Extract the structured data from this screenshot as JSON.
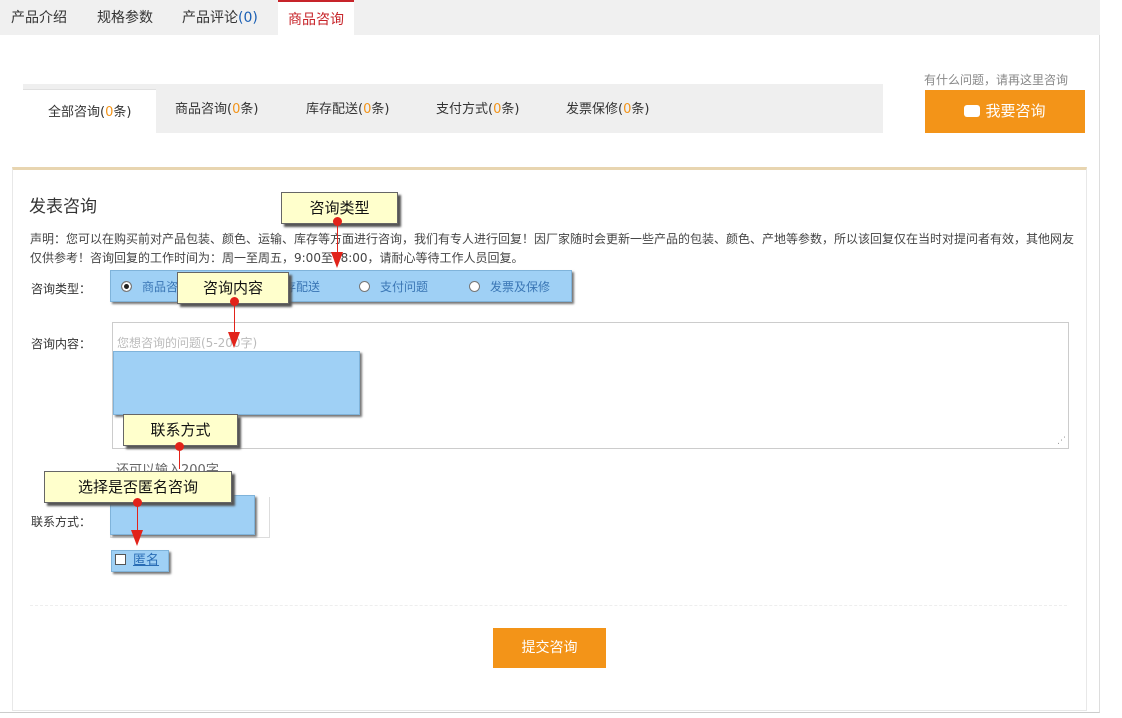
{
  "top_tabs": {
    "intro": "产品介绍",
    "specs": "规格参数",
    "reviews": "产品评论",
    "reviews_count": "(0)",
    "consult": "商品咨询"
  },
  "sub_tabs": [
    {
      "pre": "全部咨询(",
      "n": "0",
      "post": "条)"
    },
    {
      "pre": "商品咨询(",
      "n": "0",
      "post": "条)"
    },
    {
      "pre": "库存配送(",
      "n": "0",
      "post": "条)"
    },
    {
      "pre": "支付方式(",
      "n": "0",
      "post": "条)"
    },
    {
      "pre": "发票保修(",
      "n": "0",
      "post": "条)"
    }
  ],
  "ask": {
    "hint": "有什么问题，请再这里咨询",
    "button": "我要咨询",
    "icon": "chat-bubble-icon"
  },
  "form": {
    "title": "发表咨询",
    "notice": "声明：您可以在购买前对产品包装、颜色、运输、库存等方面进行咨询，我们有专人进行回复！因厂家随时会更新一些产品的包装、颜色、产地等参数，所以该回复仅在当时对提问者有效，其他网友仅供参考！咨询回复的工作时间为：周一至周五，9:00至18:00，请耐心等待工作人员回复。",
    "type_label": "咨询类型：",
    "type_options": [
      "商品咨询",
      "库存配送",
      "支付问题",
      "发票及保修"
    ],
    "content_label": "咨询内容：",
    "content_placeholder": "您想咨询的问题(5-200字)",
    "remain": "还可以输入200字",
    "contact_label": "联系方式：",
    "anonymous": "匿名",
    "submit": "提交咨询"
  },
  "callouts": {
    "type": "咨询类型",
    "content": "咨询内容",
    "contact": "联系方式",
    "anonymous": "选择是否匿名咨询"
  },
  "colors": {
    "accent_orange": "#f39418",
    "active_red": "#c7242a",
    "highlight_blue": "#9fd0f5",
    "callout_yellow": "#ffffcc",
    "pointer_red": "#e2231a"
  }
}
